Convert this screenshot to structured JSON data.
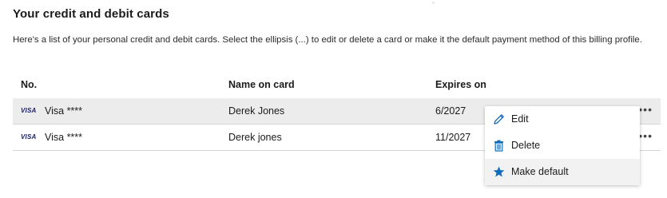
{
  "section_title": "Your credit and debit cards",
  "description": "Here's a list of your personal credit and debit cards. Select the ellipsis (...) to edit or delete a card or make it the default payment method of this billing profile.",
  "table": {
    "headers": {
      "number": "No.",
      "name": "Name on card",
      "expires": "Expires on"
    },
    "rows": [
      {
        "brand_logo": "VISA",
        "card": "Visa ****",
        "name": "Derek Jones",
        "expires": "6/2027",
        "more_label": "•••"
      },
      {
        "brand_logo": "VISA",
        "card": "Visa ****",
        "name": "Derek jones",
        "expires": "11/2027",
        "more_label": "•••"
      }
    ]
  },
  "context_menu": {
    "items": [
      {
        "label": "Edit",
        "icon": "pencil-icon"
      },
      {
        "label": "Delete",
        "icon": "trash-icon"
      },
      {
        "label": "Make default",
        "icon": "star-icon"
      }
    ]
  },
  "colors": {
    "accent": "#0f6cbd",
    "visa_blue": "#1a1f71",
    "selected_row": "#ececec"
  }
}
